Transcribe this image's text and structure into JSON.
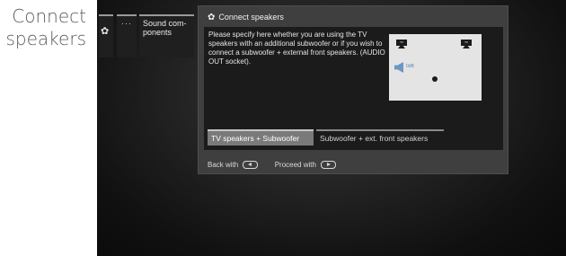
{
  "caption": "Connect\nspeakers",
  "menu": {
    "settings_icon": "gear-icon",
    "dots": "···",
    "item": "Sound com-\nponents"
  },
  "dialog": {
    "title": "Connect speakers",
    "title_icon": "gear-icon",
    "description": "Please specify here whether you are using the TV speakers with an additional subwoofer or if you wish to connect a subwoofer + external front speakers. (AUDIO OUT socket).",
    "preview": {
      "tv_left_label": "TV",
      "tv_right_label": "TV",
      "level": "0dB"
    },
    "options": [
      "TV speakers + Subwoofer",
      "Subwoofer + ext. front speakers"
    ],
    "selected_option": "TV speakers + Subwoofer",
    "footer": {
      "back": "Back with",
      "proceed": "Proceed with"
    }
  }
}
